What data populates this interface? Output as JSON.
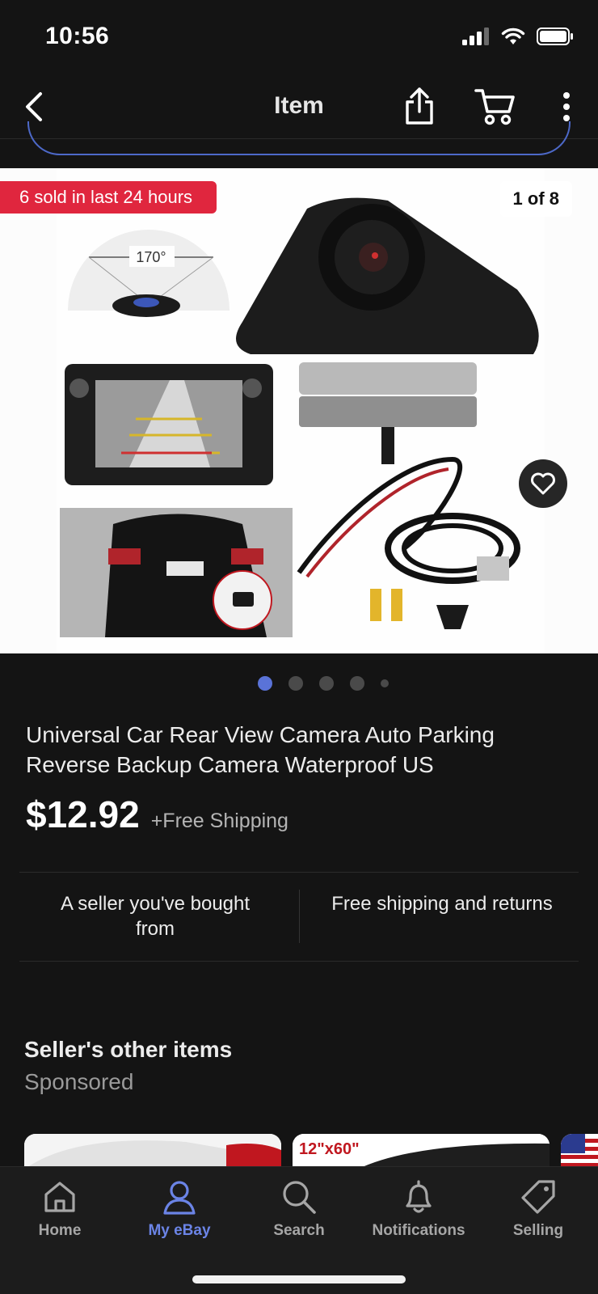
{
  "status_bar": {
    "time": "10:56"
  },
  "nav": {
    "title": "Item"
  },
  "image_gallery": {
    "badge": "6 sold in last 24 hours",
    "counter": "1 of 8",
    "angle_label": "170°",
    "total_dots": 5,
    "active_index": 0
  },
  "product": {
    "title": "Universal Car Rear View Camera Auto Parking Reverse Backup Camera Waterproof US",
    "price": "$12.92",
    "shipping": "+Free Shipping"
  },
  "features": {
    "left": "A seller you've bought from",
    "right": "Free shipping and returns"
  },
  "seller_items": {
    "title": "Seller's other items",
    "subtitle": "Sponsored",
    "card_2_label": "12\"x60\""
  },
  "tabs": [
    {
      "label": "Home",
      "icon": "home-icon"
    },
    {
      "label": "My eBay",
      "icon": "person-icon"
    },
    {
      "label": "Search",
      "icon": "search-icon"
    },
    {
      "label": "Notifications",
      "icon": "bell-icon"
    },
    {
      "label": "Selling",
      "icon": "tag-icon"
    }
  ],
  "colors": {
    "accent": "#5a73d8",
    "badge": "#e0263e",
    "background": "#141414"
  }
}
